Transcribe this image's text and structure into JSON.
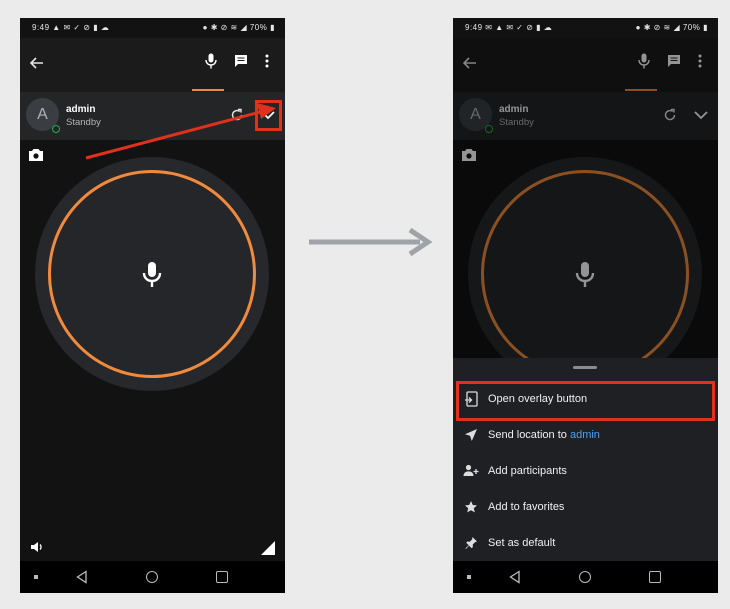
{
  "status_bar": {
    "left": {
      "time": "9:49",
      "icons": [
        "warning-icon",
        "mail-icon",
        "check-icon",
        "nfc-icon",
        "battery-saver-icon",
        "cloud-icon"
      ]
    },
    "right": {
      "icons": [
        "location-icon",
        "bluetooth-icon",
        "nfc-icon",
        "wifi-icon",
        "signal-icon"
      ],
      "battery": "70%"
    }
  },
  "contact": {
    "avatar_letter": "A",
    "name": "admin",
    "status": "Standby"
  },
  "bottom_sheet": {
    "items": [
      {
        "icon": "overlay-icon",
        "label": "Open overlay button"
      },
      {
        "icon": "send-location-icon",
        "label_prefix": "Send location to ",
        "label_link": "admin"
      },
      {
        "icon": "add-person-icon",
        "label": "Add participants"
      },
      {
        "icon": "star-icon",
        "label": "Add to favorites"
      },
      {
        "icon": "pin-icon",
        "label": "Set as default"
      }
    ]
  },
  "colors": {
    "accent": "#f08a3c",
    "annotation": "#e0301e",
    "link": "#4a9ff5",
    "online": "#18b34a",
    "transition_arrow": "#9fa3a8"
  }
}
